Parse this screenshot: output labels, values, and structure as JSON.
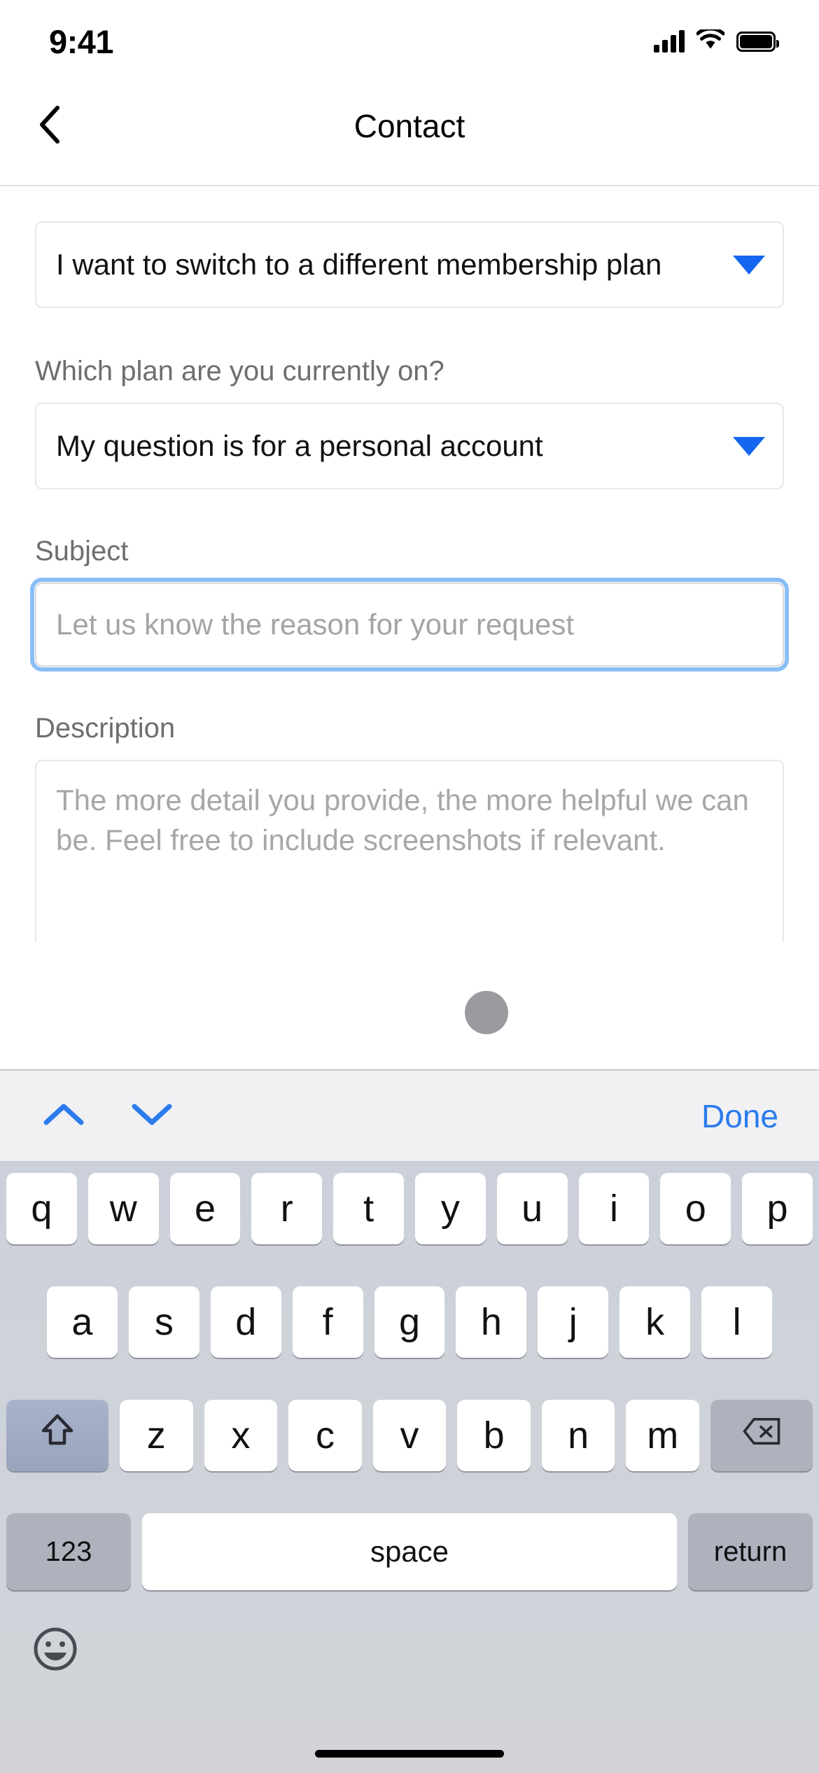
{
  "status_bar": {
    "time": "9:41",
    "signal_icon": "cellular-signal-icon",
    "wifi_icon": "wifi-icon",
    "battery_icon": "battery-icon"
  },
  "header": {
    "back_icon": "chevron-left-icon",
    "title": "Contact"
  },
  "form": {
    "topic_select": {
      "value": "I want to switch to a different membership plan",
      "arrow_icon": "triangle-down-icon"
    },
    "plan_label": "Which plan are you currently on?",
    "plan_select": {
      "value": "My question is for a personal account",
      "arrow_icon": "triangle-down-icon"
    },
    "subject_label": "Subject",
    "subject_input": {
      "value": "",
      "placeholder": "Let us know the reason for your request",
      "focused": true
    },
    "description_label": "Description",
    "description_textarea": {
      "value": "",
      "placeholder": "The more detail you provide, the more helpful we can be. Feel free to include screenshots if relevant."
    }
  },
  "touch_indicator": {
    "name": "touch-point",
    "color": "#9b9b9f"
  },
  "keyboard_accessory": {
    "prev_icon": "chevron-up-icon",
    "next_icon": "chevron-down-icon",
    "done_label": "Done",
    "accent_color": "#2b7ced"
  },
  "keyboard": {
    "row1": [
      "q",
      "w",
      "e",
      "r",
      "t",
      "y",
      "u",
      "i",
      "o",
      "p"
    ],
    "row2": [
      "a",
      "s",
      "d",
      "f",
      "g",
      "h",
      "j",
      "k",
      "l"
    ],
    "row3_letters": [
      "z",
      "x",
      "c",
      "v",
      "b",
      "n",
      "m"
    ],
    "shift_icon": "shift-arrow-icon",
    "backspace_icon": "backspace-icon",
    "numbers_label": "123",
    "space_label": "space",
    "return_label": "return",
    "emoji_icon": "emoji-smiley-icon"
  },
  "colors": {
    "blue_accent": "#1565f0",
    "focus_ring": "#89bdf5",
    "key_white": "#ffffff",
    "key_dark": "#aeb2bd",
    "keyboard_bg": "#ced2d9"
  }
}
